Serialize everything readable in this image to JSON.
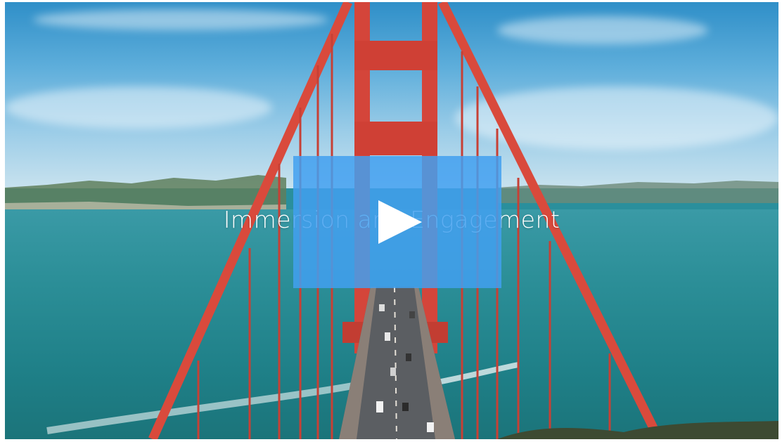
{
  "video": {
    "title": "Immersion and Engagement",
    "play_icon": "play-icon",
    "accent_color": "#42a0f0"
  }
}
